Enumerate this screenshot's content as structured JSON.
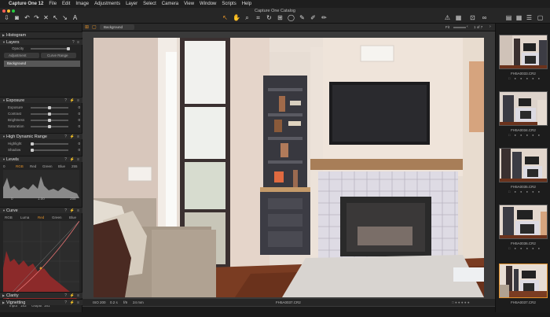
{
  "menubar": {
    "apple": "",
    "app": "Capture One 12",
    "items": [
      "File",
      "Edit",
      "Image",
      "Adjustments",
      "Layer",
      "Select",
      "Camera",
      "View",
      "Window",
      "Scripts",
      "Help"
    ]
  },
  "window_title": "Capture One Catalog",
  "viewerbar": {
    "layer_select": "Background",
    "fit": "Fit",
    "counter": "1 of 7"
  },
  "panel": {
    "histogram": "Histogram",
    "layers": "Layers",
    "opacity": "Opacity",
    "adjustment": "Adjustment",
    "curve_range": "Curve Range",
    "background_layer": "Background",
    "exposure": {
      "title": "Exposure",
      "rows": [
        {
          "label": "Exposure",
          "value": "0"
        },
        {
          "label": "Contrast",
          "value": "0"
        },
        {
          "label": "Brightness",
          "value": "0"
        },
        {
          "label": "Saturation",
          "value": "0"
        }
      ]
    },
    "hdr": {
      "title": "High Dynamic Range",
      "rows": [
        {
          "label": "Highlight",
          "value": "0"
        },
        {
          "label": "Shadow",
          "value": "0"
        }
      ]
    },
    "levels": {
      "title": "Levels",
      "tabs": [
        "RGB",
        "Red",
        "Green",
        "Blue"
      ],
      "left_value": "0",
      "right_value": "255",
      "bottom_left": "0",
      "bottom_mid": "1.00",
      "bottom_right": "255"
    },
    "curve": {
      "title": "Curve",
      "tabs": [
        "RGB",
        "Luma",
        "Red",
        "Green",
        "Blue"
      ],
      "input_label": "Input",
      "input_value": "183",
      "output_label": "Output",
      "output_value": "161"
    },
    "clarity": "Clarity",
    "vignetting": "Vignetting"
  },
  "photo_info": {
    "iso": "ISO 200",
    "shutter": "0.2 s",
    "aperture": "f/9",
    "focal": "24 mm",
    "filename": "FH5A0037.CR2"
  },
  "filmstrip": [
    {
      "name": "FH5A0033.CR2"
    },
    {
      "name": "FH5A0034.CR2"
    },
    {
      "name": "FH5A0035.CR2"
    },
    {
      "name": "FH5A0036.CR2"
    },
    {
      "name": "FH5A0037.CR2",
      "selected": true
    }
  ],
  "colors": {
    "accent": "#e0902a",
    "curve_fill": "#8c2a2a"
  }
}
